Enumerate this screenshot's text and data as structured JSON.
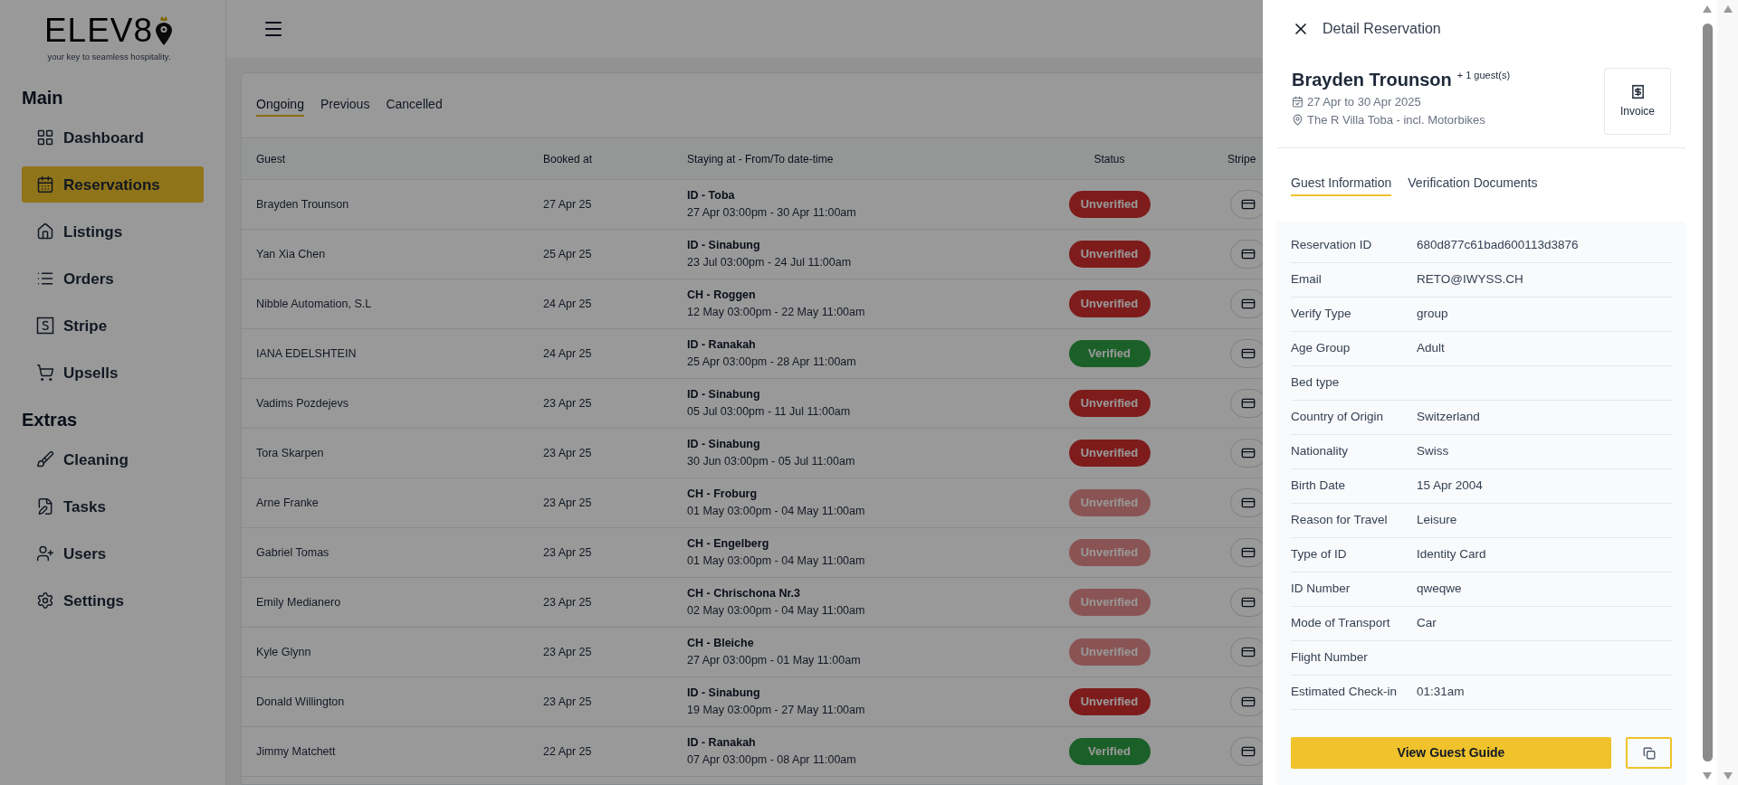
{
  "brand": {
    "logo": "ELEV8",
    "tagline": "your key to seamless hospitality."
  },
  "sidebar": {
    "sections": [
      {
        "title": "Main",
        "items": [
          {
            "label": "Dashboard",
            "selected": false
          },
          {
            "label": "Reservations",
            "selected": true
          },
          {
            "label": "Listings",
            "selected": false
          },
          {
            "label": "Orders",
            "selected": false
          },
          {
            "label": "Stripe",
            "selected": false
          },
          {
            "label": "Upsells",
            "selected": false
          }
        ]
      },
      {
        "title": "Extras",
        "items": [
          {
            "label": "Cleaning",
            "selected": false
          },
          {
            "label": "Tasks",
            "selected": false
          },
          {
            "label": "Users",
            "selected": false
          },
          {
            "label": "Settings",
            "selected": false
          }
        ]
      }
    ]
  },
  "tabs": [
    {
      "label": "Ongoing",
      "selected": true
    },
    {
      "label": "Previous",
      "selected": false
    },
    {
      "label": "Cancelled",
      "selected": false
    }
  ],
  "table": {
    "columns": [
      "Guest",
      "Booked at",
      "Staying at - From/To date-time",
      "Status",
      "Stripe"
    ],
    "rows": [
      {
        "guest": "Brayden Trounson",
        "booked": "27 Apr 25",
        "property": "ID - Toba",
        "dates": "27 Apr 03:00pm - 30 Apr 11:00am",
        "status": "Unverified",
        "verified": false,
        "faded": false
      },
      {
        "guest": "Yan Xia Chen",
        "booked": "25 Apr 25",
        "property": "ID - Sinabung",
        "dates": "23 Jul 03:00pm - 24 Jul 11:00am",
        "status": "Unverified",
        "verified": false,
        "faded": false
      },
      {
        "guest": "Nibble Automation, S.L",
        "booked": "24 Apr 25",
        "property": "CH - Roggen",
        "dates": "12 May 03:00pm - 22 May 11:00am",
        "status": "Unverified",
        "verified": false,
        "faded": false
      },
      {
        "guest": "IANA EDELSHTEIN",
        "booked": "24 Apr 25",
        "property": "ID - Ranakah",
        "dates": "25 Apr 03:00pm - 28 Apr 11:00am",
        "status": "Verified",
        "verified": true,
        "faded": false
      },
      {
        "guest": "Vadims Pozdejevs",
        "booked": "23 Apr 25",
        "property": "ID - Sinabung",
        "dates": "05 Jul 03:00pm - 11 Jul 11:00am",
        "status": "Unverified",
        "verified": false,
        "faded": false
      },
      {
        "guest": "Tora Skarpen",
        "booked": "23 Apr 25",
        "property": "ID - Sinabung",
        "dates": "30 Jun 03:00pm - 05 Jul 11:00am",
        "status": "Unverified",
        "verified": false,
        "faded": false
      },
      {
        "guest": "Arne Franke",
        "booked": "23 Apr 25",
        "property": "CH - Froburg",
        "dates": "01 May 03:00pm - 04 May 11:00am",
        "status": "Unverified",
        "verified": false,
        "faded": true
      },
      {
        "guest": "Gabriel Tomas",
        "booked": "23 Apr 25",
        "property": "CH - Engelberg",
        "dates": "01 May 03:00pm - 04 May 11:00am",
        "status": "Unverified",
        "verified": false,
        "faded": true
      },
      {
        "guest": "Emily Medianero",
        "booked": "23 Apr 25",
        "property": "CH - Chrischona Nr.3",
        "dates": "02 May 03:00pm - 04 May 11:00am",
        "status": "Unverified",
        "verified": false,
        "faded": true
      },
      {
        "guest": "Kyle Glynn",
        "booked": "23 Apr 25",
        "property": "CH - Bleiche",
        "dates": "27 Apr 03:00pm - 01 May 11:00am",
        "status": "Unverified",
        "verified": false,
        "faded": true
      },
      {
        "guest": "Donald Willington",
        "booked": "23 Apr 25",
        "property": "ID - Sinabung",
        "dates": "19 May 03:00pm - 27 May 11:00am",
        "status": "Unverified",
        "verified": false,
        "faded": false
      },
      {
        "guest": "Jimmy Matchett",
        "booked": "22 Apr 25",
        "property": "ID - Ranakah",
        "dates": "07 Apr 03:00pm - 08 Apr 11:00am",
        "status": "Verified",
        "verified": true,
        "faded": false
      }
    ]
  },
  "drawer": {
    "title": "Detail Reservation",
    "guest_name": "Brayden Trounson",
    "extra_guests": "+ 1 guest(s)",
    "dates": "27 Apr to 30 Apr 2025",
    "location": "The R Villa Toba - incl. Motorbikes",
    "invoice_label": "Invoice",
    "tabs": [
      {
        "label": "Guest Information",
        "selected": true
      },
      {
        "label": "Verification Documents",
        "selected": false
      }
    ],
    "fields": [
      {
        "label": "Reservation ID",
        "value": "680d877c61bad600113d3876"
      },
      {
        "label": "Email",
        "value": "RETO@IWYSS.CH"
      },
      {
        "label": "Verify Type",
        "value": "group"
      },
      {
        "label": "Age Group",
        "value": "Adult"
      },
      {
        "label": "Bed type"
      },
      {
        "label": "Country of Origin",
        "value": "Switzerland"
      },
      {
        "label": "Nationality",
        "value": "Swiss"
      },
      {
        "label": "Birth Date",
        "value": "15 Apr 2004"
      },
      {
        "label": "Reason for Travel",
        "value": "Leisure"
      },
      {
        "label": "Type of ID",
        "value": "Identity Card"
      },
      {
        "label": "ID Number",
        "value": "qweqwe"
      },
      {
        "label": "Mode of Transport",
        "value": "Car"
      },
      {
        "label": "Flight Number"
      },
      {
        "label": "Estimated Check-in",
        "value": "01:31am"
      }
    ],
    "guide_button": "View Guest Guide"
  }
}
